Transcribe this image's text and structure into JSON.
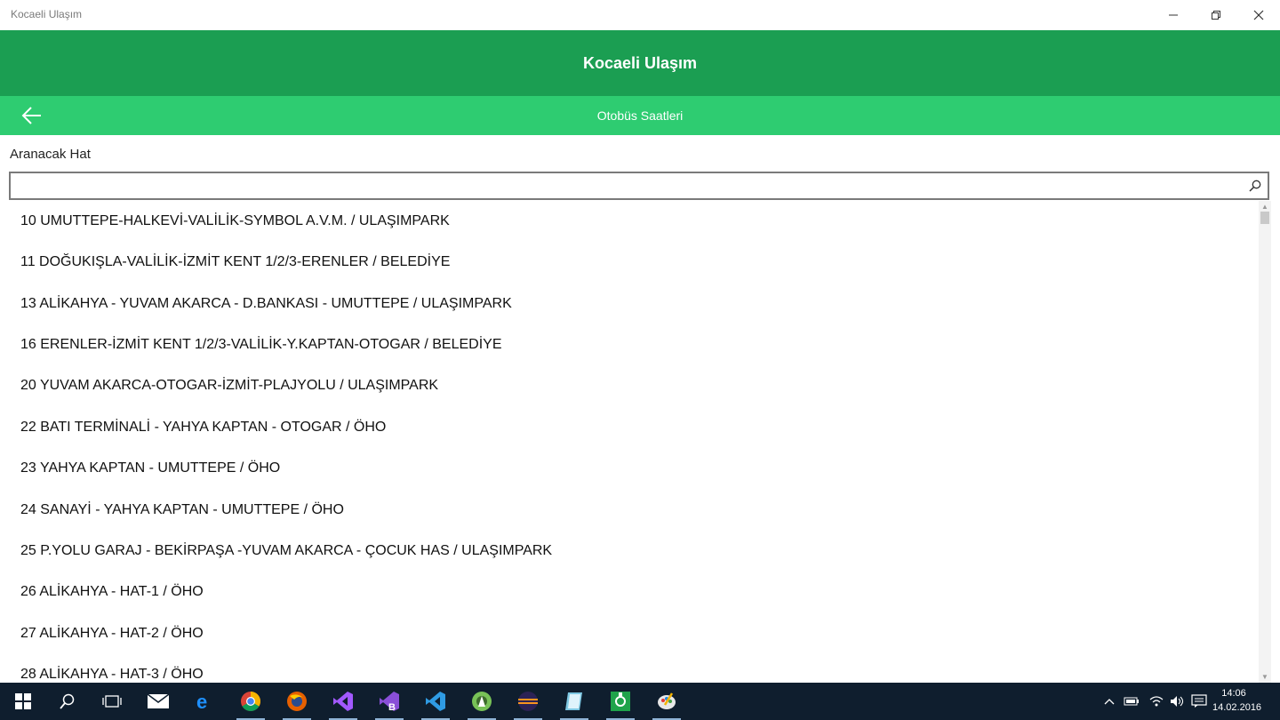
{
  "window": {
    "title": "Kocaeli Ulaşım"
  },
  "header": {
    "title": "Kocaeli Ulaşım",
    "subtitle": "Otobüs Saatleri",
    "back_icon": "arrow-left-icon"
  },
  "search": {
    "label": "Aranacak Hat",
    "value": "",
    "placeholder": ""
  },
  "routes": [
    "10 UMUTTEPE-HALKEVİ-VALİLİK-SYMBOL A.V.M. / ULAŞIMPARK",
    "11 DOĞUKIŞLA-VALİLİK-İZMİT KENT 1/2/3-ERENLER / BELEDİYE",
    "13 ALİKAHYA - YUVAM AKARCA - D.BANKASI - UMUTTEPE / ULAŞIMPARK",
    "16 ERENLER-İZMİT KENT 1/2/3-VALİLİK-Y.KAPTAN-OTOGAR / BELEDİYE",
    "20 YUVAM AKARCA-OTOGAR-İZMİT-PLAJYOLU / ULAŞIMPARK",
    "22 BATI TERMİNALİ - YAHYA KAPTAN - OTOGAR / ÖHO",
    "23 YAHYA KAPTAN - UMUTTEPE / ÖHO",
    "24 SANAYİ - YAHYA KAPTAN - UMUTTEPE / ÖHO",
    "25 P.YOLU GARAJ - BEKİRPAŞA -YUVAM AKARCA - ÇOCUK HAS / ULAŞIMPARK",
    "26 ALİKAHYA - HAT-1 / ÖHO",
    "27 ALİKAHYA - HAT-2 / ÖHO",
    "28 ALİKAHYA - HAT-3 / ÖHO"
  ],
  "taskbar": {
    "time": "14:06",
    "date": "14.02.2016",
    "icons": [
      "windows-start-icon",
      "search-icon",
      "task-view-icon",
      "mail-icon",
      "edge-icon",
      "chrome-icon",
      "firefox-icon",
      "visual-studio-icon",
      "visual-studio-blend-icon",
      "vscode-icon",
      "android-studio-icon",
      "eclipse-icon",
      "notepad-icon",
      "app-icon",
      "paint-icon"
    ]
  },
  "colors": {
    "header": "#1b9e52",
    "subheader": "#2ecc71",
    "taskbar": "#0f1e2e"
  }
}
